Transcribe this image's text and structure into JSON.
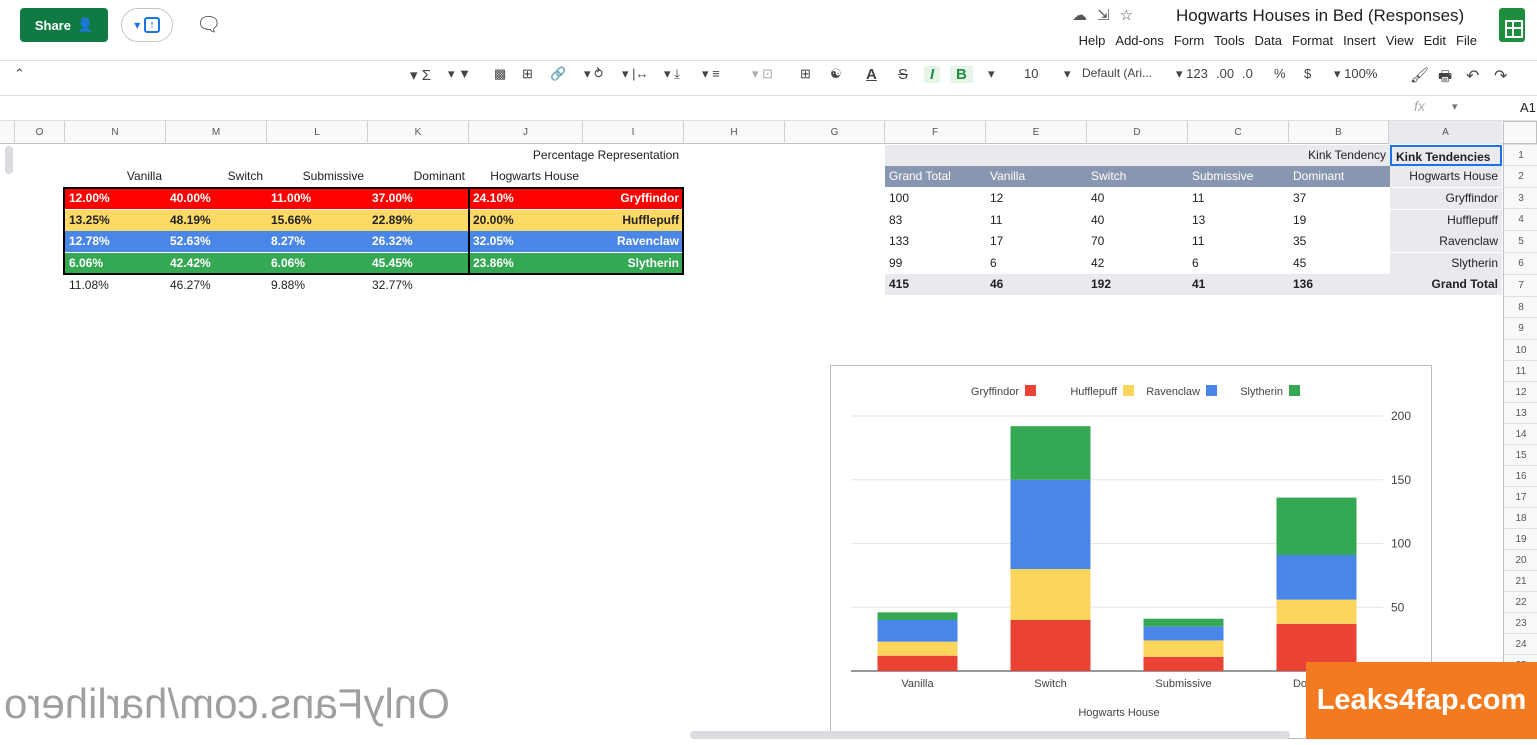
{
  "header": {
    "share_label": "Share",
    "doc_title": "Hogwarts Houses in Bed (Responses)",
    "menus": [
      "File",
      "Edit",
      "View",
      "Insert",
      "Format",
      "Data",
      "Tools",
      "Form",
      "Add-ons",
      "Help"
    ]
  },
  "toolbar": {
    "zoom": "100%",
    "currency": "$",
    "percent": "%",
    "dec_less": ".0",
    "dec_more": ".00",
    "format_more": "123",
    "font": "Default (Ari...",
    "font_size": "10",
    "bold": "B",
    "italic": "I",
    "strike": "S",
    "text_color": "A",
    "sum": "Σ"
  },
  "formula_bar": {
    "cell_ref": "A1",
    "fx": "fx"
  },
  "columns": [
    "A",
    "B",
    "C",
    "D",
    "E",
    "F",
    "G",
    "H",
    "I",
    "J",
    "K",
    "L",
    "M",
    "N",
    "O"
  ],
  "rows": [
    "1",
    "2",
    "3",
    "4",
    "5",
    "6",
    "7",
    "8",
    "9",
    "10",
    "11",
    "12",
    "13",
    "14",
    "15",
    "16",
    "17",
    "18",
    "19",
    "20",
    "21",
    "22",
    "23",
    "24",
    "25"
  ],
  "pivot": {
    "title": "Kink Tendencies",
    "col_group": "Kink Tendency",
    "row_label": "Hogwarts House",
    "headers": [
      "Dominant",
      "Submissive",
      "Switch",
      "Vanilla",
      "Grand Total"
    ],
    "rows": [
      {
        "house": "Gryffindor",
        "values": [
          "37",
          "11",
          "40",
          "12",
          "100"
        ]
      },
      {
        "house": "Hufflepuff",
        "values": [
          "19",
          "13",
          "40",
          "11",
          "83"
        ]
      },
      {
        "house": "Ravenclaw",
        "values": [
          "35",
          "11",
          "70",
          "17",
          "133"
        ]
      },
      {
        "house": "Slytherin",
        "values": [
          "45",
          "6",
          "42",
          "6",
          "99"
        ]
      }
    ],
    "total": {
      "label": "Grand Total",
      "values": [
        "136",
        "41",
        "192",
        "46",
        "415"
      ]
    }
  },
  "percent_table": {
    "title": "Percentage Representation",
    "headers": [
      "Hogwarts House",
      "Dominant",
      "Submissive",
      "Switch",
      "Vanilla"
    ],
    "rows": [
      {
        "house": "Gryffindor",
        "values": [
          "24.10%",
          "37.00%",
          "11.00%",
          "40.00%",
          "12.00%"
        ],
        "color": "#ff0000"
      },
      {
        "house": "Hufflepuff",
        "values": [
          "20.00%",
          "22.89%",
          "15.66%",
          "48.19%",
          "13.25%"
        ],
        "color": "#ffd966"
      },
      {
        "house": "Ravenclaw",
        "values": [
          "32.05%",
          "26.32%",
          "8.27%",
          "52.63%",
          "12.78%"
        ],
        "color": "#4a86e8"
      },
      {
        "house": "Slytherin",
        "values": [
          "23.86%",
          "45.45%",
          "6.06%",
          "42.42%",
          "6.06%"
        ],
        "color": "#34a853"
      }
    ],
    "totals": [
      "32.77%",
      "9.88%",
      "46.27%",
      "11.08%"
    ]
  },
  "chart_data": {
    "type": "bar",
    "stacked": true,
    "categories": [
      "Dominant",
      "Submissive",
      "Switch",
      "Vanilla"
    ],
    "series": [
      {
        "name": "Gryffindor",
        "color": "#ea4335",
        "values": [
          37,
          11,
          40,
          12
        ]
      },
      {
        "name": "Hufflepuff",
        "color": "#fbd55c",
        "values": [
          19,
          13,
          40,
          11
        ]
      },
      {
        "name": "Ravenclaw",
        "color": "#4a86e8",
        "values": [
          35,
          11,
          70,
          17
        ]
      },
      {
        "name": "Slytherin",
        "color": "#34a853",
        "values": [
          45,
          6,
          42,
          6
        ]
      }
    ],
    "xlabel": "Hogwarts House",
    "ylabel": "",
    "yticks": [
      "50",
      "100",
      "150",
      "200"
    ],
    "ylim": [
      0,
      200
    ],
    "legend": "top",
    "grid": true
  },
  "watermarks": {
    "left": "OnlyFans.com/harlihero",
    "right": "Leaks4fap.com"
  }
}
